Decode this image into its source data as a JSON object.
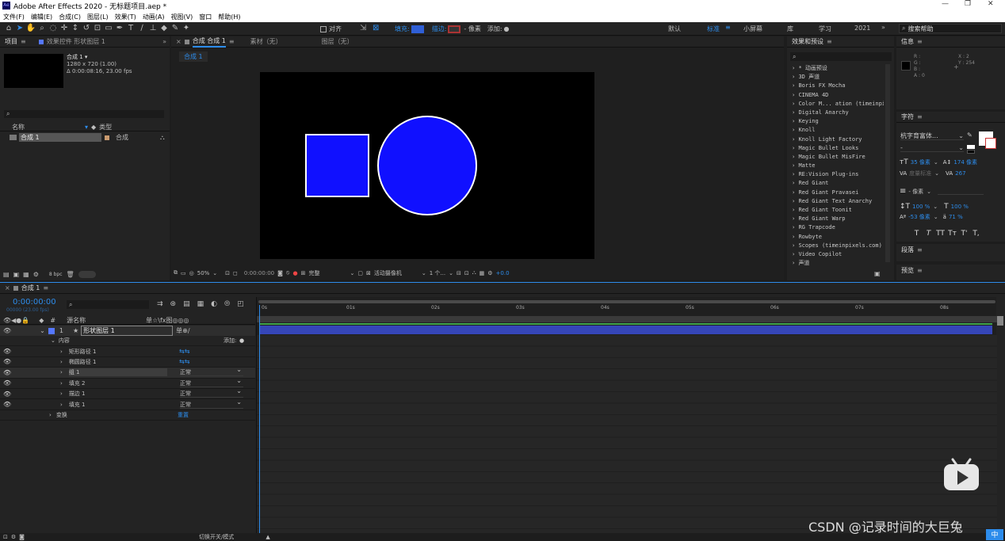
{
  "titlebar": {
    "app_title": "Adobe After Effects 2020 - 无标题项目.aep *",
    "logo": "Ae"
  },
  "menubar": {
    "items": [
      "文件(F)",
      "编辑(E)",
      "合成(C)",
      "图层(L)",
      "效果(T)",
      "动画(A)",
      "视图(V)",
      "窗口",
      "帮助(H)"
    ]
  },
  "toolbar": {
    "align_label": "对齐",
    "fill_label": "填充:",
    "stroke_label": "描边:",
    "stroke_px": "- 像素",
    "add_label": "添加:",
    "workspaces": [
      "默认",
      "标准",
      "小屏幕",
      "库",
      "学习",
      "2021"
    ],
    "active_workspace": "标准",
    "search_placeholder": "搜索帮助"
  },
  "project": {
    "tab_project": "项目",
    "tab_effects": "效果控件 形状图层 1",
    "comp_name": "合成 1 ▾",
    "comp_size": "1280 x 720 (1.00)",
    "comp_duration": "Δ 0:00:08:16, 23.00 fps",
    "col_name": "名称",
    "col_type": "类型",
    "item_name": "合成 1",
    "item_type": "合成",
    "bpc": "8 bpc"
  },
  "viewer": {
    "tab_comp": "合成 合成 1",
    "tab_footage": "素材（无）",
    "tab_layer": "图层（无）",
    "breadcrumb": "合成 1",
    "zoom": "50%",
    "timecode": "0:00:00:00",
    "quality": "完整",
    "camera": "活动摄像机",
    "views": "1 个...",
    "exposure": "+0.0",
    "square_color": "#1010ff",
    "circle_color": "#1010ff"
  },
  "effects_panel": {
    "title": "效果和预设",
    "items": [
      "* 动画预设",
      "3D 声道",
      "Boris FX Mocha",
      "CINEMA 4D",
      "Color M... ation (timeinpixel",
      "Digital Anarchy",
      "Keying",
      "Knoll",
      "Knoll Light Factory",
      "Magic Bullet Looks",
      "Magic Bullet MisFire",
      "Matte",
      "RE:Vision Plug-ins",
      "Red Giant",
      "Red Giant Pravasei",
      "Red Giant Text Anarchy",
      "Red Giant Toonit",
      "Red Giant Warp",
      "RG Trapcode",
      "Rowbyte",
      "Scopes (timeinpixels.com)",
      "Video Copilot",
      "声道"
    ]
  },
  "info_panel": {
    "title": "信息",
    "r": "R :",
    "g": "G :",
    "b": "B :",
    "a": "A : 0",
    "x": "X : 2",
    "y": "Y : 254"
  },
  "character_panel": {
    "title": "字符",
    "font": "杭字育富体...",
    "size": "35 像素",
    "leading": "174 像素",
    "tracking_label": "度量标准",
    "tracking": "267",
    "vscale": "100 %",
    "hscale": "100 %",
    "baseline": "-53 像素",
    "tsume": "71 %",
    "stroke_width": "- 像素",
    "buttons": [
      "T",
      "T",
      "TT",
      "Tт",
      "T'",
      "T,"
    ]
  },
  "paragraph_panel": {
    "title": "段落"
  },
  "preview_panel": {
    "title": "预览"
  },
  "timeline": {
    "tab": "合成 1",
    "timecode": "0:00:00:00",
    "frames": "00000 (23.00 fps)",
    "col_source": "源名称",
    "col_switches": "单☆\\fx图◎◎◎",
    "layer_num": "1",
    "layer_name": "形状图层 1",
    "contents": "内容",
    "add_label": "添加:",
    "rows": [
      {
        "name": "矩形路径 1",
        "mode": ""
      },
      {
        "name": "椭圆路径 1",
        "mode": ""
      },
      {
        "name": "组 1",
        "mode": "正常"
      },
      {
        "name": "填充 2",
        "mode": "正常"
      },
      {
        "name": "描边 1",
        "mode": "正常"
      },
      {
        "name": "填充 1",
        "mode": "正常"
      }
    ],
    "transform": "变换",
    "reset": "重置",
    "ticks": [
      "0s",
      "01s",
      "02s",
      "03s",
      "04s",
      "05s",
      "06s",
      "07s",
      "08s"
    ],
    "footer": "切换开关/模式"
  },
  "watermark": {
    "text": "CSDN @记录时间的大巨兔"
  },
  "colors": {
    "accent": "#2d8ceb",
    "layer_bar": "#3546b8",
    "shape_blue": "#1010ff"
  }
}
